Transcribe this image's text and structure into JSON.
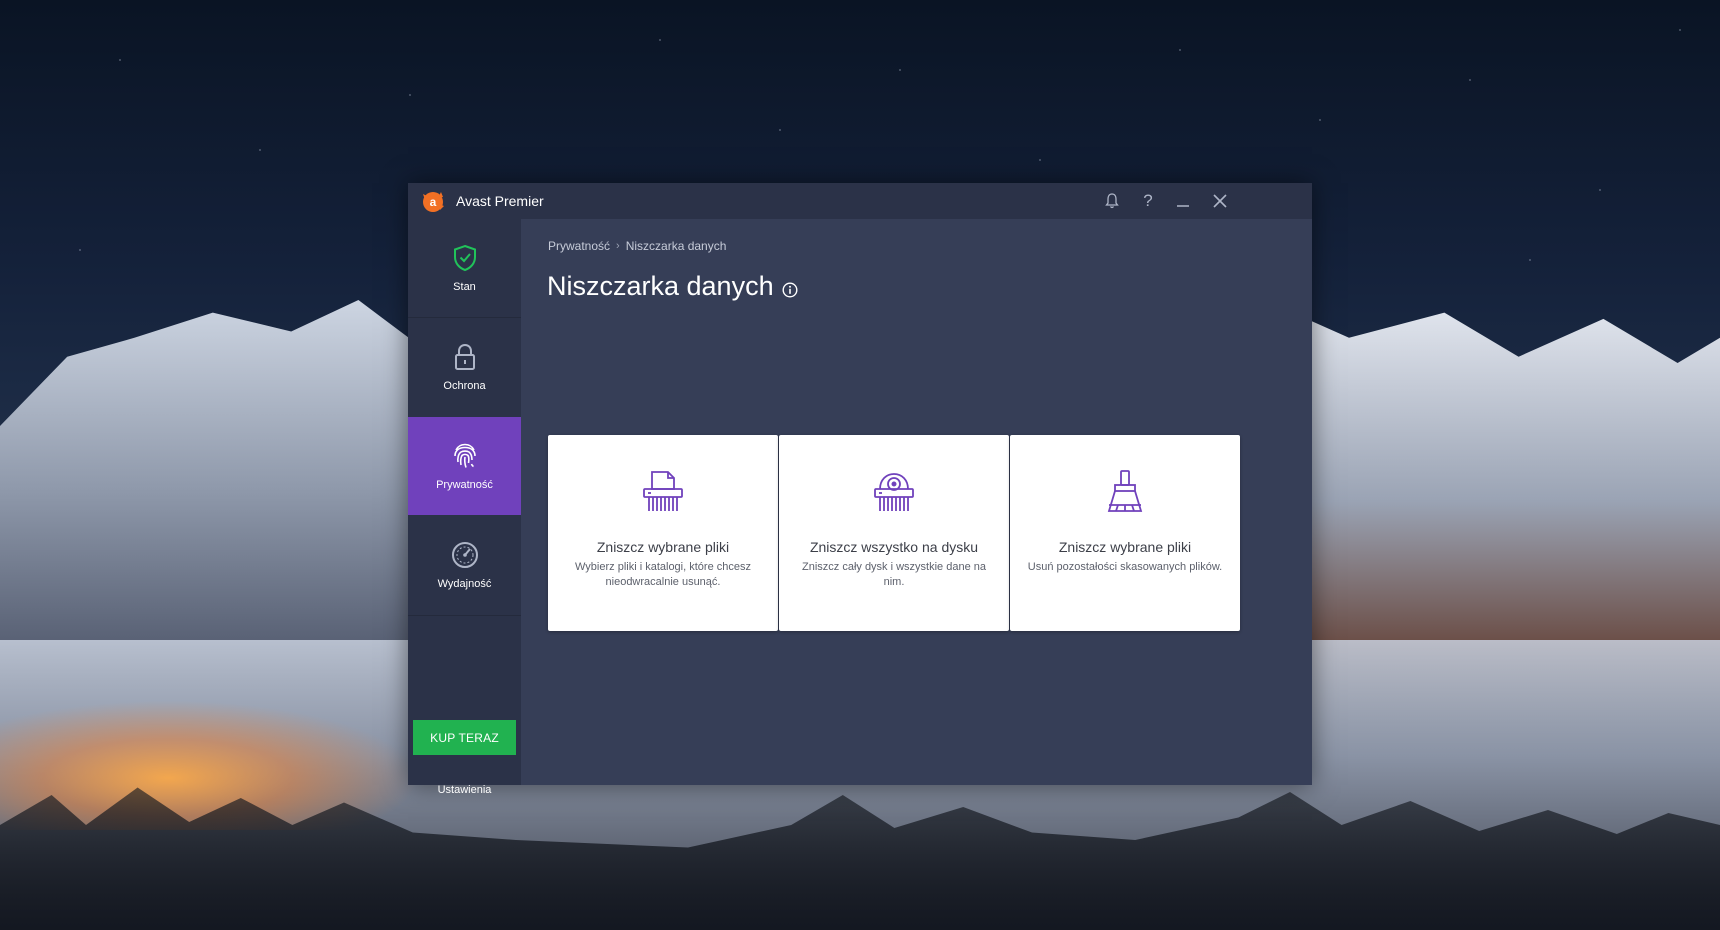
{
  "window": {
    "title": "Avast Premier",
    "colors": {
      "accent": "#7041bc",
      "buy": "#21b250",
      "sidebar": "#2b3248",
      "content": "#363e57"
    }
  },
  "titlebar": {
    "icons": [
      "bell-icon",
      "help-icon",
      "minimize-icon",
      "close-icon"
    ],
    "help_glyph": "?"
  },
  "sidebar": {
    "items": [
      {
        "label": "Stan",
        "icon": "shield-check-icon"
      },
      {
        "label": "Ochrona",
        "icon": "lock-icon"
      },
      {
        "label": "Prywatność",
        "icon": "fingerprint-icon",
        "active": true
      },
      {
        "label": "Wydajność",
        "icon": "speedometer-icon"
      }
    ],
    "buy_label": "KUP TERAZ",
    "settings_label": "Ustawienia"
  },
  "main": {
    "breadcrumb": {
      "parent": "Prywatność",
      "separator": "›",
      "current": "Niszczarka danych"
    },
    "title": "Niszczarka danych",
    "cards": [
      {
        "title": "Zniszcz wybrane pliki",
        "description": "Wybierz pliki i katalogi, które chcesz nieodwracalnie usunąć.",
        "icon": "file-shredder-icon"
      },
      {
        "title": "Zniszcz wszystko na dysku",
        "description": "Zniszcz cały dysk i wszystkie dane na nim.",
        "icon": "disk-shredder-icon"
      },
      {
        "title": "Zniszcz wybrane pliki",
        "description": "Usuń pozostałości skasowanych plików.",
        "icon": "broom-icon"
      }
    ]
  }
}
